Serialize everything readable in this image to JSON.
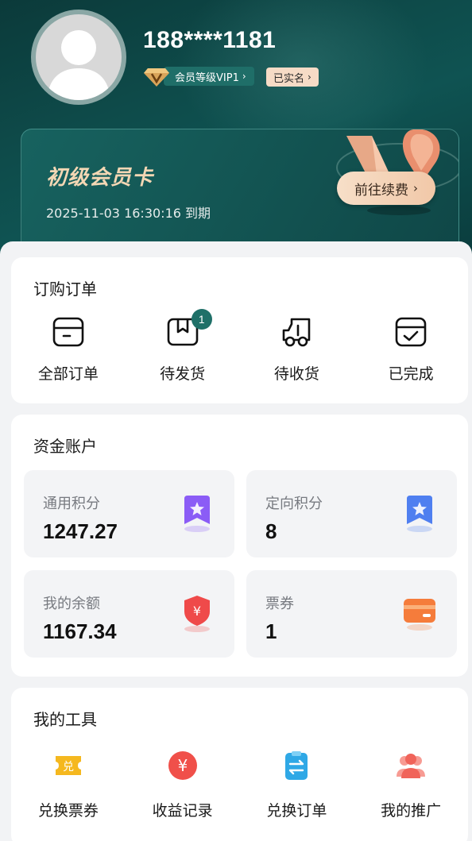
{
  "profile": {
    "phone": "188****1181",
    "vip_level": "会员等级VIP1",
    "verified": "已实名"
  },
  "member_card": {
    "title": "初级会员卡",
    "expiry": "2025-11-03 16:30:16 到期",
    "renew_label": "前往续费"
  },
  "orders": {
    "title": "订购订单",
    "items": [
      {
        "label": "全部订单",
        "icon": "all-orders-icon"
      },
      {
        "label": "待发货",
        "icon": "pending-shipment-icon",
        "badge": "1"
      },
      {
        "label": "待收货",
        "icon": "pending-receipt-icon"
      },
      {
        "label": "已完成",
        "icon": "completed-icon"
      }
    ]
  },
  "funds": {
    "title": "资金账户",
    "items": [
      {
        "label": "通用积分",
        "value": "1247.27",
        "icon": "bookmark-star-icon",
        "color": "#8b5cf6"
      },
      {
        "label": "定向积分",
        "value": "8",
        "icon": "bookmark-star-icon",
        "color": "#4f7ff0"
      },
      {
        "label": "我的余额",
        "value": "1167.34",
        "icon": "yuan-shield-icon",
        "color": "#ef4a4a"
      },
      {
        "label": "票券",
        "value": "1",
        "icon": "card-icon",
        "color": "#f57c3b"
      }
    ]
  },
  "tools": {
    "title": "我的工具",
    "items": [
      {
        "label": "兑换票券",
        "icon": "exchange-ticket-icon",
        "color": "#f5b81f"
      },
      {
        "label": "收益记录",
        "icon": "yuan-circle-icon",
        "color": "#f0504a"
      },
      {
        "label": "兑换订单",
        "icon": "exchange-order-icon",
        "color": "#2fa8e6"
      },
      {
        "label": "我的推广",
        "icon": "users-icon",
        "color": "#f0645a"
      }
    ]
  }
}
